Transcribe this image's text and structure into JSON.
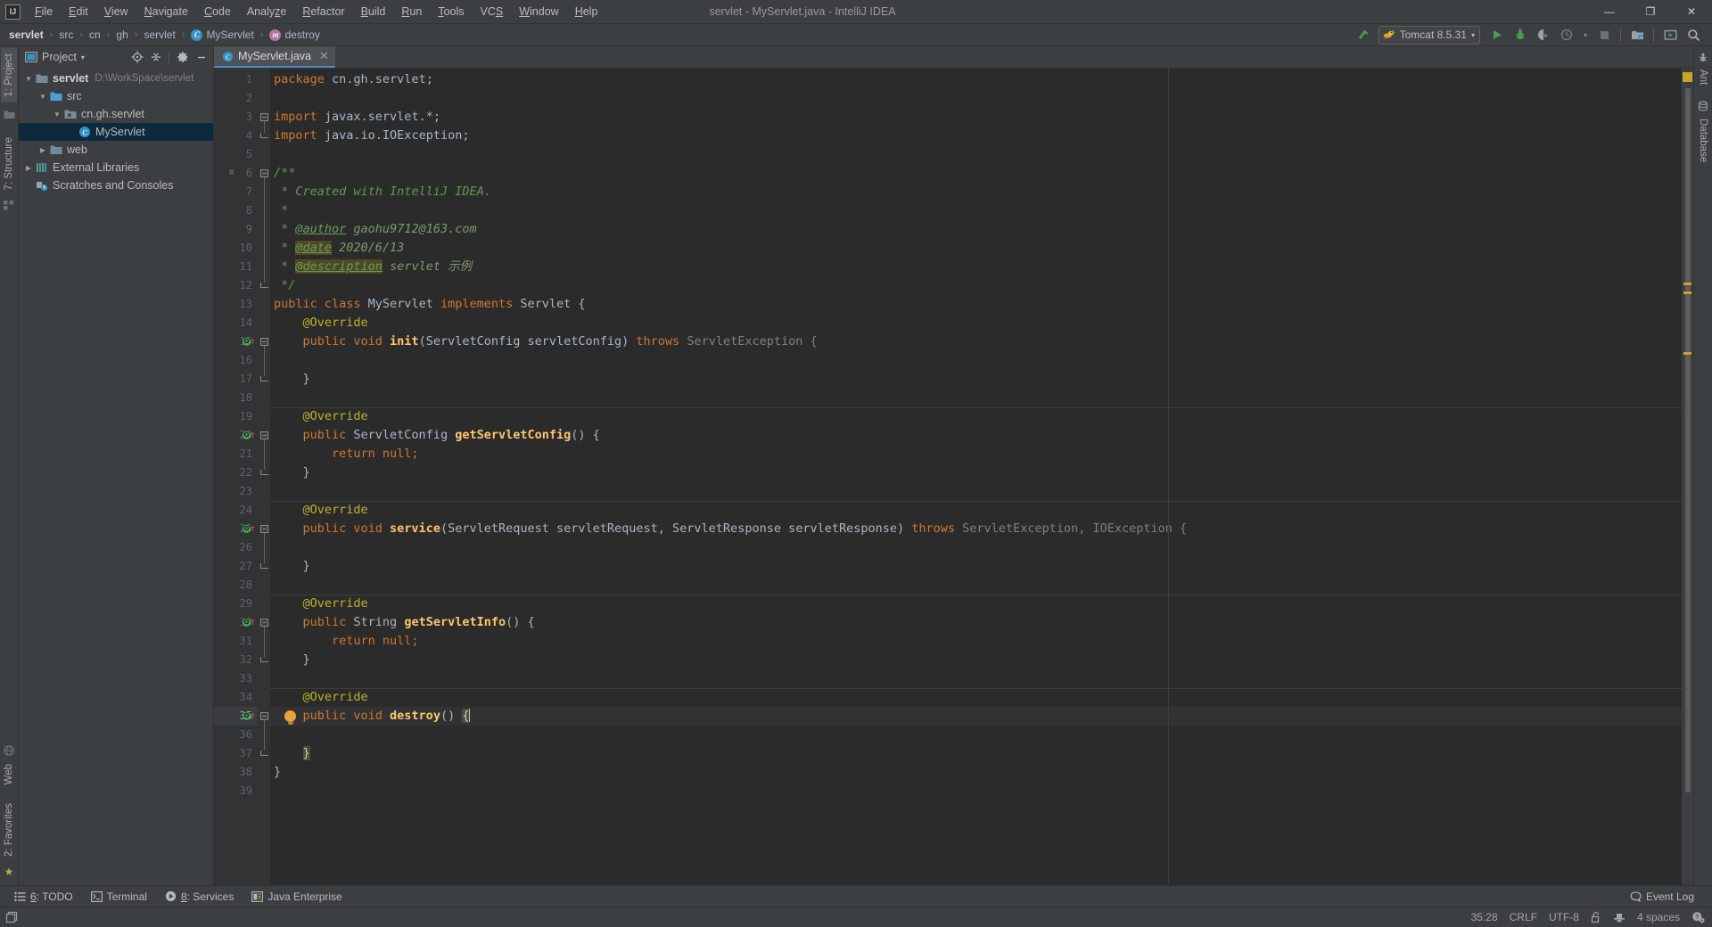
{
  "window": {
    "title": "servlet - MyServlet.java - IntelliJ IDEA",
    "logo": "IJ",
    "minimize": "—",
    "maximize": "❐",
    "close": "✕"
  },
  "menubar": {
    "items": [
      {
        "label": "File",
        "mnemonic": "F"
      },
      {
        "label": "Edit",
        "mnemonic": "E"
      },
      {
        "label": "View",
        "mnemonic": "V"
      },
      {
        "label": "Navigate",
        "mnemonic": "N"
      },
      {
        "label": "Code",
        "mnemonic": "C"
      },
      {
        "label": "Analyze",
        "mnemonic": "z"
      },
      {
        "label": "Refactor",
        "mnemonic": "R"
      },
      {
        "label": "Build",
        "mnemonic": "B"
      },
      {
        "label": "Run",
        "mnemonic": "R"
      },
      {
        "label": "Tools",
        "mnemonic": "T"
      },
      {
        "label": "VCS",
        "mnemonic": "S"
      },
      {
        "label": "Window",
        "mnemonic": "W"
      },
      {
        "label": "Help",
        "mnemonic": "H"
      }
    ]
  },
  "breadcrumb": {
    "items": [
      {
        "label": "servlet",
        "type": "module"
      },
      {
        "label": "src",
        "type": "folder"
      },
      {
        "label": "cn",
        "type": "folder"
      },
      {
        "label": "gh",
        "type": "folder"
      },
      {
        "label": "servlet",
        "type": "folder"
      },
      {
        "label": "MyServlet",
        "type": "class",
        "icon_glyph": "C"
      },
      {
        "label": "destroy",
        "type": "method",
        "icon_glyph": "m"
      }
    ],
    "separator": "›"
  },
  "toolbar": {
    "build_icon": "hammer-icon",
    "run_config": {
      "name": "Tomcat 8.5.31",
      "icon": "tomcat-icon",
      "dropdown": "▾"
    },
    "buttons": [
      {
        "name": "run-button",
        "icon": "play-icon"
      },
      {
        "name": "debug-button",
        "icon": "bug-icon"
      },
      {
        "name": "run-with-coverage-button",
        "icon": "coverage-icon"
      },
      {
        "name": "profile-button",
        "icon": "profile-icon"
      },
      {
        "name": "stop-button",
        "icon": "stop-icon"
      },
      {
        "name": "project-structure-button",
        "icon": "project-structure-icon"
      },
      {
        "name": "update-app-button",
        "icon": "update-icon"
      },
      {
        "name": "search-everywhere-button",
        "icon": "search-icon"
      }
    ]
  },
  "left_strip": {
    "top": [
      {
        "label": "1: Project",
        "mnemonic": "1",
        "active": true
      }
    ],
    "middle": [
      {
        "label": "7: Structure",
        "mnemonic": "7",
        "active": false
      }
    ],
    "bottom": [
      {
        "label": "Web",
        "active": false
      },
      {
        "label": "2: Favorites",
        "mnemonic": "2",
        "active": false
      }
    ]
  },
  "right_strip": {
    "items": [
      {
        "label": "Ant",
        "icon": "ant-icon"
      },
      {
        "label": "Database",
        "icon": "database-icon"
      }
    ]
  },
  "project_panel": {
    "title": "Project",
    "dropdown": "▾",
    "tools": [
      {
        "name": "scroll-from-source-button",
        "icon": "target-icon"
      },
      {
        "name": "collapse-all-button",
        "icon": "collapse-icon"
      },
      {
        "name": "settings-button",
        "icon": "gear-icon"
      },
      {
        "name": "hide-button",
        "icon": "minimize-icon"
      }
    ],
    "tree": [
      {
        "label": "servlet",
        "path": "D:\\WorkSpace\\servlet",
        "indent": 0,
        "arrow": "open",
        "icon": "module-icon",
        "bold": true,
        "selected": false
      },
      {
        "label": "src",
        "path": "",
        "indent": 1,
        "arrow": "open",
        "icon": "source-folder-icon",
        "bold": false,
        "selected": false
      },
      {
        "label": "cn.gh.servlet",
        "path": "",
        "indent": 2,
        "arrow": "open",
        "icon": "package-icon",
        "bold": false,
        "selected": false
      },
      {
        "label": "MyServlet",
        "path": "",
        "indent": 3,
        "arrow": "none",
        "icon": "class-icon",
        "bold": false,
        "selected": true
      },
      {
        "label": "web",
        "path": "",
        "indent": 1,
        "arrow": "closed",
        "icon": "web-folder-icon",
        "bold": false,
        "selected": false
      },
      {
        "label": "External Libraries",
        "path": "",
        "indent": 0,
        "arrow": "closed",
        "icon": "libraries-icon",
        "bold": false,
        "selected": false
      },
      {
        "label": "Scratches and Consoles",
        "path": "",
        "indent": 0,
        "arrow": "none",
        "icon": "scratches-icon",
        "bold": false,
        "selected": false
      }
    ]
  },
  "editor": {
    "tab": {
      "label": "MyServlet.java",
      "icon": "java-class-icon",
      "close": "✕"
    },
    "caret_line": 35,
    "lines": [
      {
        "n": 1,
        "tokens": [
          {
            "t": "package ",
            "c": "kw"
          },
          {
            "t": "cn.gh.servlet;",
            "c": "punc"
          }
        ]
      },
      {
        "n": 2,
        "tokens": []
      },
      {
        "n": 3,
        "tokens": [
          {
            "t": "import ",
            "c": "kw"
          },
          {
            "t": "javax.servlet.*;",
            "c": "punc"
          }
        ],
        "fold": "start"
      },
      {
        "n": 4,
        "tokens": [
          {
            "t": "import ",
            "c": "kw"
          },
          {
            "t": "java.io.IOException;",
            "c": "punc"
          }
        ],
        "fold": "end"
      },
      {
        "n": 5,
        "tokens": []
      },
      {
        "n": 6,
        "tokens": [
          {
            "t": "/**",
            "c": "cmt"
          }
        ],
        "fold": "start",
        "doc": true
      },
      {
        "n": 7,
        "tokens": [
          {
            "t": " * Created with IntelliJ IDEA.",
            "c": "cmt"
          }
        ]
      },
      {
        "n": 8,
        "tokens": [
          {
            "t": " *",
            "c": "cmt"
          }
        ]
      },
      {
        "n": 9,
        "tokens": [
          {
            "t": " * ",
            "c": "cmt"
          },
          {
            "t": "@author",
            "c": "tag"
          },
          {
            "t": " gaohu9712@163.com",
            "c": "cmt-txt"
          }
        ]
      },
      {
        "n": 10,
        "tokens": [
          {
            "t": " * ",
            "c": "cmt"
          },
          {
            "t": "@date",
            "c": "tag tag-hl"
          },
          {
            "t": " 2020/6/13",
            "c": "cmt-txt"
          }
        ]
      },
      {
        "n": 11,
        "tokens": [
          {
            "t": " * ",
            "c": "cmt"
          },
          {
            "t": "@description",
            "c": "tag tag-hl"
          },
          {
            "t": " servlet 示例",
            "c": "cmt-txt"
          }
        ]
      },
      {
        "n": 12,
        "tokens": [
          {
            "t": " */",
            "c": "cmt"
          }
        ],
        "fold": "end"
      },
      {
        "n": 13,
        "tokens": [
          {
            "t": "public class ",
            "c": "kw"
          },
          {
            "t": "MyServlet ",
            "c": "typ"
          },
          {
            "t": "implements ",
            "c": "kw"
          },
          {
            "t": "Servlet {",
            "c": "typ"
          }
        ]
      },
      {
        "n": 14,
        "tokens": [
          {
            "t": "    @Override",
            "c": "ann"
          }
        ]
      },
      {
        "n": 15,
        "tokens": [
          {
            "t": "    public void ",
            "c": "kw"
          },
          {
            "t": "init",
            "c": "mthb"
          },
          {
            "t": "(ServletConfig servletConfig) ",
            "c": "typ"
          },
          {
            "t": "throws ",
            "c": "kw"
          },
          {
            "t": "ServletException {",
            "c": "grey"
          }
        ],
        "gutter": "override",
        "fold": "start"
      },
      {
        "n": 16,
        "tokens": []
      },
      {
        "n": 17,
        "tokens": [
          {
            "t": "    }",
            "c": "punc"
          }
        ],
        "fold": "end"
      },
      {
        "n": 18,
        "tokens": [],
        "sep": true
      },
      {
        "n": 19,
        "tokens": [
          {
            "t": "    @Override",
            "c": "ann"
          }
        ]
      },
      {
        "n": 20,
        "tokens": [
          {
            "t": "    public ",
            "c": "kw"
          },
          {
            "t": "ServletConfig ",
            "c": "typ"
          },
          {
            "t": "getServletConfig",
            "c": "mthb"
          },
          {
            "t": "() {",
            "c": "punc"
          }
        ],
        "gutter": "override",
        "fold": "start"
      },
      {
        "n": 21,
        "tokens": [
          {
            "t": "        return ",
            "c": "kw"
          },
          {
            "t": "null;",
            "c": "kw"
          }
        ]
      },
      {
        "n": 22,
        "tokens": [
          {
            "t": "    }",
            "c": "punc"
          }
        ],
        "fold": "end"
      },
      {
        "n": 23,
        "tokens": [],
        "sep": true
      },
      {
        "n": 24,
        "tokens": [
          {
            "t": "    @Override",
            "c": "ann"
          }
        ]
      },
      {
        "n": 25,
        "tokens": [
          {
            "t": "    public void ",
            "c": "kw"
          },
          {
            "t": "service",
            "c": "mthb"
          },
          {
            "t": "(ServletRequest servletRequest, ServletResponse servletResponse) ",
            "c": "typ"
          },
          {
            "t": "throws ",
            "c": "kw"
          },
          {
            "t": "ServletException, IOException {",
            "c": "grey"
          }
        ],
        "gutter": "override",
        "fold": "start"
      },
      {
        "n": 26,
        "tokens": []
      },
      {
        "n": 27,
        "tokens": [
          {
            "t": "    }",
            "c": "punc"
          }
        ],
        "fold": "end"
      },
      {
        "n": 28,
        "tokens": [],
        "sep": true
      },
      {
        "n": 29,
        "tokens": [
          {
            "t": "    @Override",
            "c": "ann"
          }
        ]
      },
      {
        "n": 30,
        "tokens": [
          {
            "t": "    public ",
            "c": "kw"
          },
          {
            "t": "String ",
            "c": "typ"
          },
          {
            "t": "getServletInfo",
            "c": "mthb"
          },
          {
            "t": "() {",
            "c": "punc"
          }
        ],
        "gutter": "override",
        "fold": "start"
      },
      {
        "n": 31,
        "tokens": [
          {
            "t": "        return ",
            "c": "kw"
          },
          {
            "t": "null;",
            "c": "kw"
          }
        ]
      },
      {
        "n": 32,
        "tokens": [
          {
            "t": "    }",
            "c": "punc"
          }
        ],
        "fold": "end"
      },
      {
        "n": 33,
        "tokens": [],
        "sep": true
      },
      {
        "n": 34,
        "tokens": [
          {
            "t": "    @Override",
            "c": "ann"
          }
        ]
      },
      {
        "n": 35,
        "tokens": [
          {
            "t": "    public void ",
            "c": "kw"
          },
          {
            "t": "destroy",
            "c": "mthb"
          },
          {
            "t": "() ",
            "c": "punc"
          },
          {
            "t": "{",
            "c": "brace-hl"
          }
        ],
        "gutter": "override",
        "fold": "start",
        "bulb": true
      },
      {
        "n": 36,
        "tokens": []
      },
      {
        "n": 37,
        "tokens": [
          {
            "t": "    ",
            "c": "punc"
          },
          {
            "t": "}",
            "c": "brace-hl"
          }
        ],
        "fold": "end"
      },
      {
        "n": 38,
        "tokens": [
          {
            "t": "}",
            "c": "punc"
          }
        ]
      },
      {
        "n": 39,
        "tokens": []
      }
    ]
  },
  "error_stripe": {
    "warning_color": "#c9a227",
    "top_box": true,
    "marks": [
      240,
      250,
      318
    ]
  },
  "tool_window_bar": {
    "items": [
      {
        "label": "6: TODO",
        "mnemonic": "6",
        "icon": "todo-icon"
      },
      {
        "label": "Terminal",
        "mnemonic": "",
        "icon": "terminal-icon"
      },
      {
        "label": "8: Services",
        "mnemonic": "8",
        "icon": "services-icon"
      },
      {
        "label": "Java Enterprise",
        "mnemonic": "",
        "icon": "java-enterprise-icon"
      }
    ],
    "event_log": {
      "label": "Event Log",
      "icon": "balloon-icon"
    }
  },
  "statusbar": {
    "left_icon": "memory-indicator-icon",
    "right": [
      {
        "label": "35:28",
        "name": "caret-position"
      },
      {
        "label": "CRLF",
        "name": "line-separator"
      },
      {
        "label": "UTF-8",
        "name": "file-encoding"
      },
      {
        "label": "",
        "name": "lock-icon",
        "icon": "unlocked-icon"
      },
      {
        "label": "",
        "name": "git-branch-icon",
        "icon": "hat-icon"
      },
      {
        "label": "4 spaces",
        "name": "indent-setting"
      },
      {
        "label": "",
        "name": "inspection-level-icon",
        "icon": "face-gear-icon"
      }
    ]
  },
  "colors": {
    "bg_chrome": "#3c3f41",
    "bg_editor": "#2b2b2b",
    "bg_gutter": "#313335",
    "accent": "#4a88c7",
    "selection": "#0d293e",
    "keyword": "#cc7832",
    "method": "#ffc66d",
    "comment": "#629755",
    "annotation": "#bbb529",
    "green_run": "#499c54",
    "warning": "#c9a227"
  }
}
